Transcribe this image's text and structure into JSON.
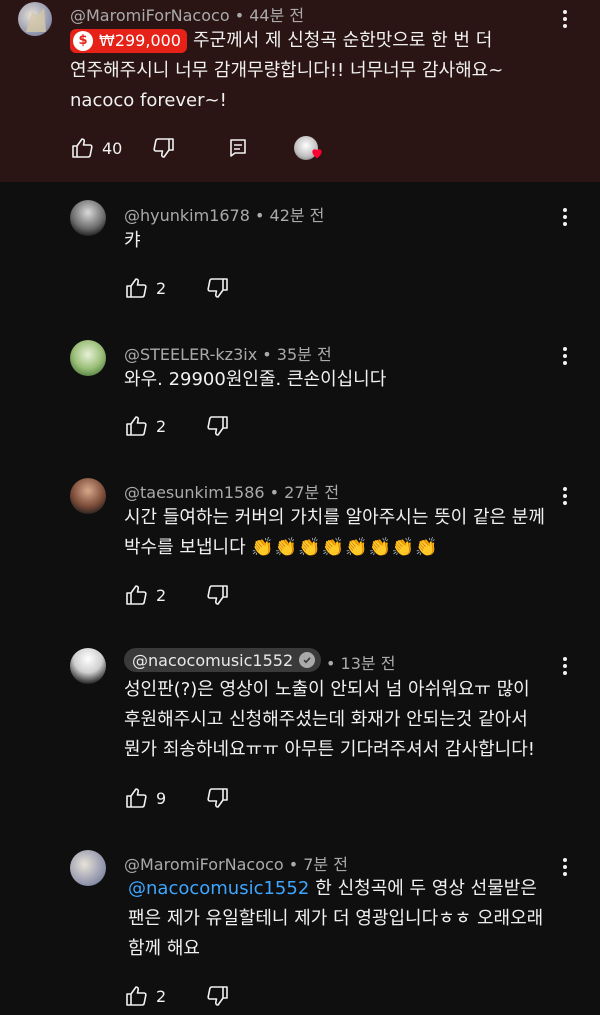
{
  "comments": [
    {
      "handle": "@MaromiForNacoco",
      "time": "44분 전",
      "superchat_amount": "₩299,000",
      "lines": [
        "주군께서 제 신청곡 순한맛으로 한 번 더",
        "연주해주시니 너무 감개무량합니다!! 너무너무 감사해요~",
        "nacoco forever~!"
      ],
      "likes": "40"
    },
    {
      "handle": "@hyunkim1678",
      "time": "42분 전",
      "lines": [
        "캬"
      ],
      "likes": "2"
    },
    {
      "handle": "@STEELER-kz3ix",
      "time": "35분 전",
      "lines": [
        "와우. 29900원인줄. 큰손이십니다"
      ],
      "likes": "2"
    },
    {
      "handle": "@taesunkim1586",
      "time": "27분 전",
      "lines": [
        "시간 들여하는 커버의 가치를 알아주시는 뜻이 같은 분께",
        "박수를 보냅니다"
      ],
      "emoji": "👏👏👏👏👏👏👏👏",
      "likes": "2"
    },
    {
      "handle": "@nacocomusic1552",
      "time": "13분 전",
      "lines": [
        "성인판(?)은 영상이 노출이 안되서 넘 아쉬워요ㅠ 많이",
        "후원해주시고 신청해주셨는데 화재가 안되는것 같아서",
        "뭔가 죄송하네요ㅠㅠ 아무튼 기다려주셔서 감사합니다!"
      ],
      "likes": "9"
    },
    {
      "handle": "@MaromiForNacoco",
      "time": "7분 전",
      "mention": "@nacocomusic1552",
      "lines": [
        "한 신청곡에 두 영상 선물받은",
        "팬은 제가 유일할테니 제가 더 영광입니다ㅎㅎ 오래오래",
        "함께 해요"
      ],
      "likes": "2"
    }
  ],
  "colors": {
    "superchat_bg": "#2a1414",
    "superchat_badge": "#e62117",
    "mention": "#3ea6ff",
    "page_bg": "#0f0f0f"
  }
}
